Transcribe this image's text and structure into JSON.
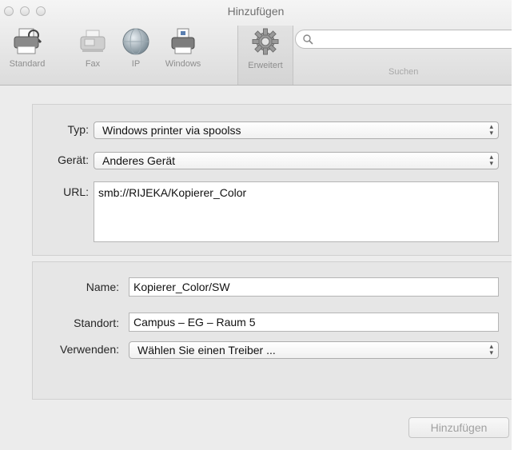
{
  "window": {
    "title": "Hinzufügen"
  },
  "toolbar": {
    "items": [
      {
        "label": "Standard",
        "icon": "printer-icon"
      },
      {
        "label": "Fax",
        "icon": "fax-icon"
      },
      {
        "label": "IP",
        "icon": "globe-icon"
      },
      {
        "label": "Windows",
        "icon": "windows-printer-icon"
      },
      {
        "label": "Erweitert",
        "icon": "gear-icon",
        "selected": true
      }
    ],
    "search": {
      "placeholder": "",
      "label": "Suchen",
      "icon": "search-icon"
    }
  },
  "connection": {
    "type_label": "Typ:",
    "type_value": "Windows printer via spoolss",
    "device_label": "Gerät:",
    "device_value": "Anderes Gerät",
    "url_label": "URL:",
    "url_value": "smb://RIJEKA/Kopierer_Color"
  },
  "details": {
    "name_label": "Name:",
    "name_value": "Kopierer_Color/SW",
    "location_label": "Standort:",
    "location_value": "Campus – EG – Raum 5",
    "use_label": "Verwenden:",
    "use_value": "Wählen Sie einen Treiber ..."
  },
  "footer": {
    "add_label": "Hinzufügen"
  },
  "colors": {
    "accent": "#ececec",
    "disabled_text": "#a0a0a0"
  }
}
